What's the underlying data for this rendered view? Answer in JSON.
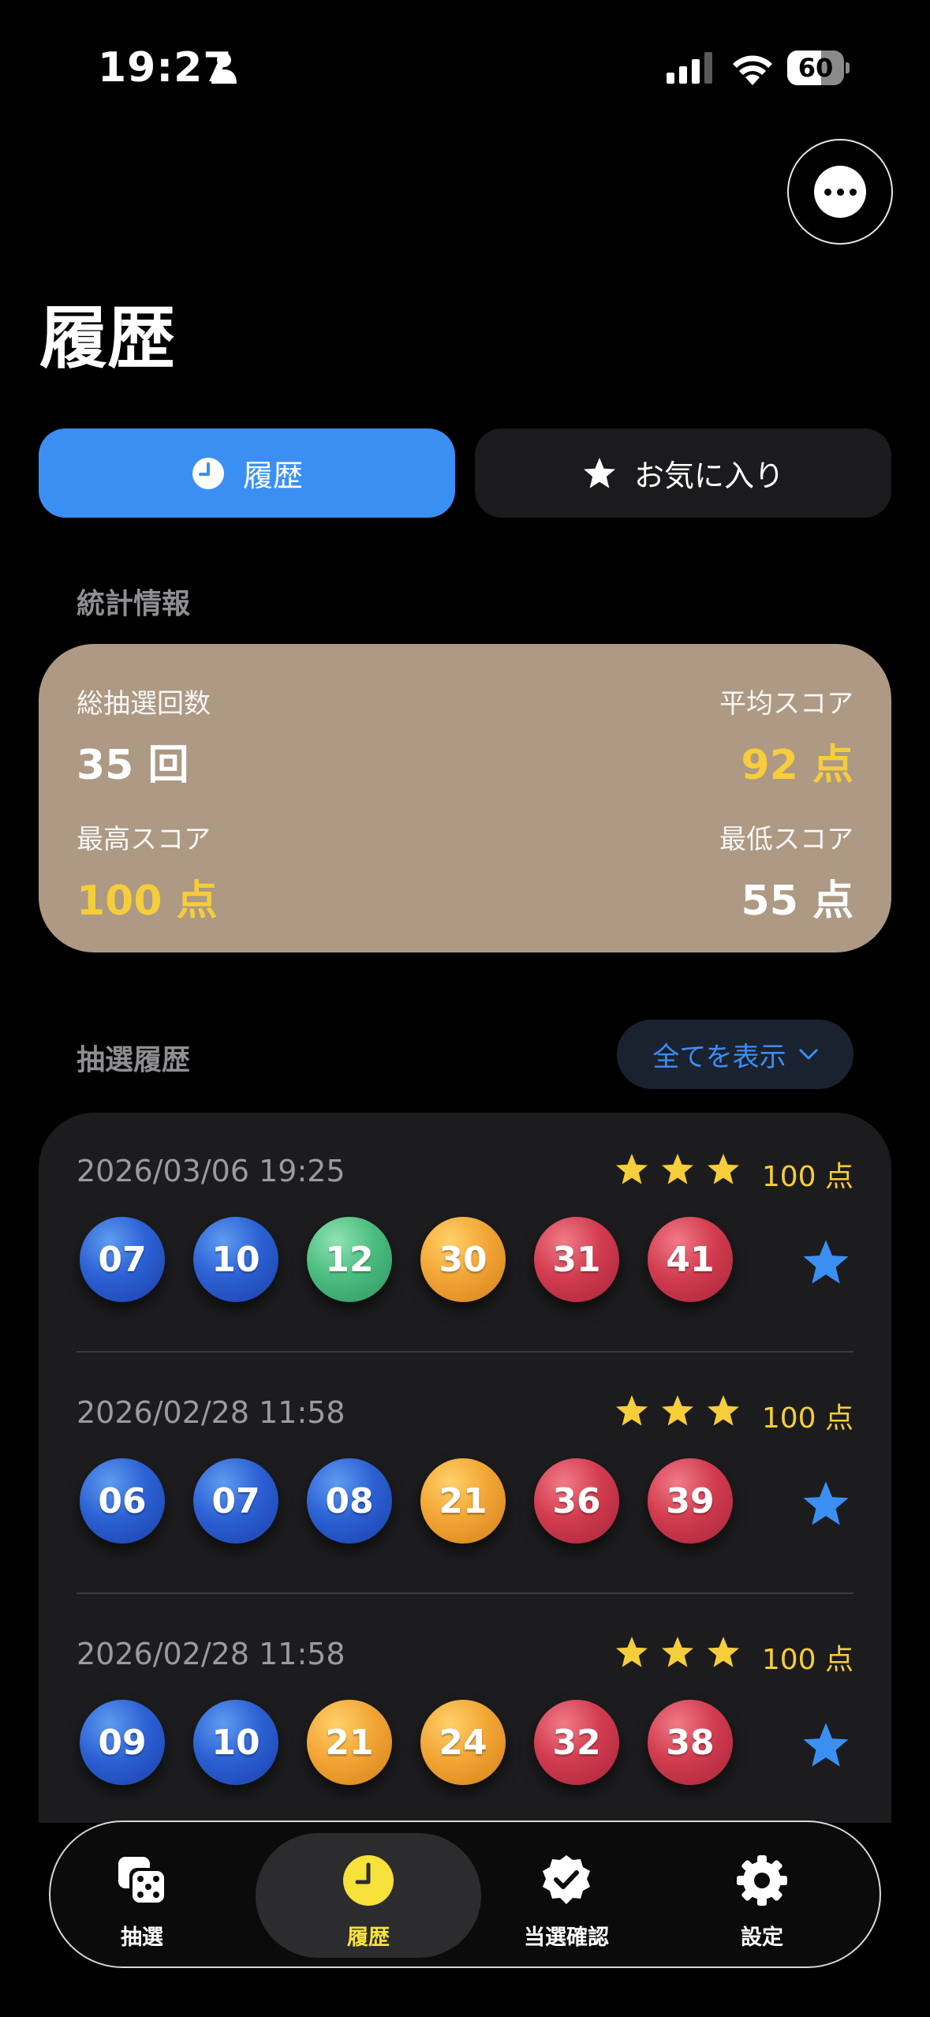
{
  "status_bar": {
    "time": "19:27",
    "battery": "60",
    "battery_level": 0.6
  },
  "header": {
    "title": "履歴"
  },
  "segmented_tabs": [
    {
      "label": "履歴",
      "icon": "clock-icon",
      "selected": true
    },
    {
      "label": "お気に入り",
      "icon": "star-icon",
      "selected": false
    }
  ],
  "stats": {
    "section_label": "統計情報",
    "total_draws": {
      "label": "総抽選回数",
      "value": "35 回"
    },
    "average_score": {
      "label": "平均スコア",
      "value": "92 点"
    },
    "highest_score": {
      "label": "最高スコア",
      "value": "100 点"
    },
    "lowest_score": {
      "label": "最低スコア",
      "value": "55 点"
    }
  },
  "history": {
    "section_label": "抽選履歴",
    "filter_label": "全てを表示",
    "entries": [
      {
        "date": "2026/03/06 19:25",
        "stars": 3,
        "score": "100 点",
        "numbers": [
          "07",
          "10",
          "12",
          "30",
          "31",
          "41"
        ],
        "colors": [
          "blue",
          "blue",
          "green",
          "orange",
          "red",
          "red"
        ],
        "favorite": true
      },
      {
        "date": "2026/02/28 11:58",
        "stars": 3,
        "score": "100 点",
        "numbers": [
          "06",
          "07",
          "08",
          "21",
          "36",
          "39"
        ],
        "colors": [
          "blue",
          "blue",
          "blue",
          "orange",
          "red",
          "red"
        ],
        "favorite": true
      },
      {
        "date": "2026/02/28 11:58",
        "stars": 3,
        "score": "100 点",
        "numbers": [
          "09",
          "10",
          "21",
          "24",
          "32",
          "38"
        ],
        "colors": [
          "blue",
          "blue",
          "orange",
          "orange",
          "red",
          "red"
        ],
        "favorite": true
      }
    ]
  },
  "tabbar": [
    {
      "label": "抽選",
      "icon": "dice-icon",
      "active": false
    },
    {
      "label": "履歴",
      "icon": "clock-icon",
      "active": true
    },
    {
      "label": "当選確認",
      "icon": "checkmark-seal-icon",
      "active": false
    },
    {
      "label": "設定",
      "icon": "gear-icon",
      "active": false
    }
  ],
  "colors": {
    "accent": "#3b8ff2",
    "gold": "#f6cd3a",
    "stats_card": "#ad9984",
    "card_bg": "#1c1c1e",
    "ball_blue": "#2c61d4",
    "ball_green": "#4cbd7f",
    "ball_orange": "#f2a636",
    "ball_red": "#d23c4f"
  }
}
